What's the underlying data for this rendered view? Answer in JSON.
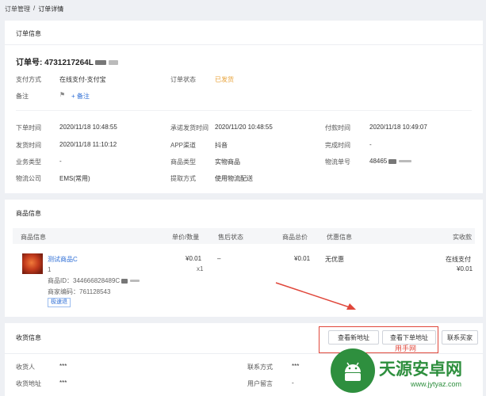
{
  "breadcrumb": {
    "parent": "订单管理",
    "sep": "/",
    "current": "订单详情"
  },
  "order_section": {
    "title": "订单信息",
    "order_no_label": "订单号:",
    "order_no_value": "4731217264L",
    "fields": {
      "pay_method_label": "支付方式",
      "pay_method_value": "在线支付-支付宝",
      "status_label": "订单状态",
      "status_value": "已发货",
      "remark_label": "备注",
      "remark_action": "+ 备注",
      "order_time_label": "下单时间",
      "order_time_value": "2020/11/18 10:48:55",
      "promise_time_label": "承诺发货时间",
      "promise_time_value": "2020/11/20 10:48:55",
      "pay_time_label": "付款时间",
      "pay_time_value": "2020/11/18 10:49:07",
      "ship_time_label": "发货时间",
      "ship_time_value": "2020/11/18 11:10:12",
      "app_channel_label": "APP渠道",
      "app_channel_value": "抖音",
      "finish_time_label": "完成时间",
      "finish_time_value": "-",
      "biz_type_label": "业务类型",
      "biz_type_value": "-",
      "goods_type_label": "商品类型",
      "goods_type_value": "实物商品",
      "waybill_label": "物流单号",
      "waybill_value": "48465",
      "logistics_label": "物流公司",
      "logistics_value": "EMS(常用)",
      "pickup_label": "提取方式",
      "pickup_value": "使用物流配送"
    }
  },
  "goods_section": {
    "title": "商品信息",
    "columns": [
      "商品信息",
      "单价/数量",
      "售后状态",
      "商品总价",
      "优惠信息",
      "实收款"
    ],
    "item": {
      "name": "测试商品C",
      "qty_line": "1",
      "product_id": "商品ID：344666828489C",
      "merchant_code": "商家编码：761128543",
      "tag": "极速退",
      "unit_price": "¥0.01",
      "quantity": "x1",
      "after_sale": "–",
      "total": "¥0.01",
      "discount": "无优惠",
      "paid_method": "在线支付",
      "paid_amount": "¥0.01"
    }
  },
  "shipping_section": {
    "title": "收货信息",
    "buttons": {
      "view_new_address": "查看新地址",
      "view_order_address": "查看下单地址",
      "contact_buyer": "联系买家"
    },
    "annotation": "用手网",
    "fields": {
      "receiver_label": "收货人",
      "receiver_value": "***",
      "contact_label": "联系方式",
      "contact_value": "***",
      "address_label": "收货地址",
      "address_value": "***",
      "message_label": "用户留言",
      "message_value": "-"
    }
  },
  "watermark": {
    "brand": "天源安卓网",
    "url": "www.jytyaz.com"
  },
  "colors": {
    "accent": "#2f6fd6",
    "status": "#e8a33b",
    "highlight": "#e0473b"
  }
}
